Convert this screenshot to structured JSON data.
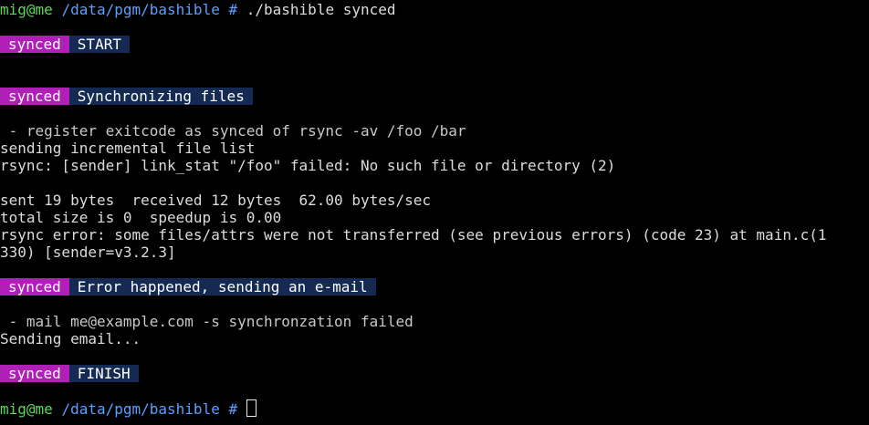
{
  "prompt": {
    "user": "mig@me",
    "path": "/data/pgm/bashible",
    "symbol": "#",
    "command": "./bashible synced"
  },
  "blocks": [
    {
      "tag": "synced",
      "message": "START"
    },
    {
      "tag": "synced",
      "message": "Synchronizing files"
    },
    {
      "tag": "synced",
      "message": "Error happened, sending an e-mail"
    },
    {
      "tag": "synced",
      "message": "FINISH"
    }
  ],
  "output": {
    "register_line": " - register exitcode as synced of rsync -av /foo /bar",
    "sending_list": "sending incremental file list",
    "rsync_link_stat": "rsync: [sender] link_stat \"/foo\" failed: No such file or directory (2)",
    "sent_line": "sent 19 bytes  received 12 bytes  62.00 bytes/sec",
    "total_line": "total size is 0  speedup is 0.00",
    "rsync_error_1": "rsync error: some files/attrs were not transferred (see previous errors) (code 23) at main.c(1",
    "rsync_error_2": "330) [sender=v3.2.3]",
    "mail_line": " - mail me@example.com -s synchronzation failed",
    "sending_email": "Sending email..."
  },
  "final_prompt": {
    "user": "mig@me",
    "path": "/data/pgm/bashible",
    "symbol": "#"
  },
  "colors": {
    "background": "#000000",
    "user": "#5cd65c",
    "path": "#5aa0ff",
    "tag_bg": "#b020b8",
    "message_bg": "#142a52"
  }
}
